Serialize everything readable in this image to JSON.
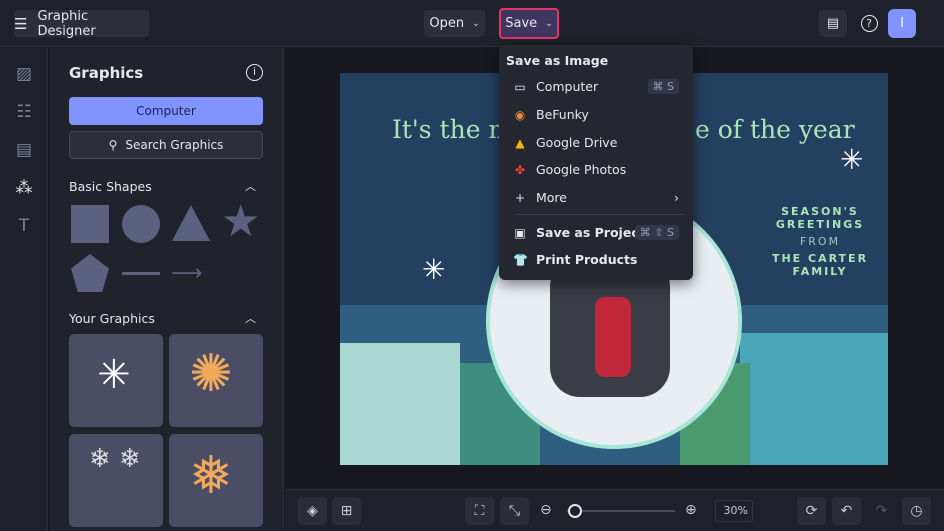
{
  "header": {
    "app_title": "Graphic Designer",
    "open_label": "Open",
    "save_label": "Save",
    "avatar_initial": "I"
  },
  "panel": {
    "title": "Graphics",
    "computer_label": "Computer",
    "search_label": "Search Graphics",
    "basic_shapes": "Basic Shapes",
    "your_graphics": "Your Graphics"
  },
  "save_menu": {
    "heading": "Save as Image",
    "items": [
      {
        "label": "Computer",
        "shortcut": "⌘ S"
      },
      {
        "label": "BeFunky"
      },
      {
        "label": "Google Drive"
      },
      {
        "label": "Google Photos"
      },
      {
        "label": "More"
      }
    ],
    "project": {
      "label": "Save as Project",
      "shortcut": "⌘ ⇧ S"
    },
    "print": {
      "label": "Print Products"
    }
  },
  "card": {
    "headline_left": "It's the mo",
    "headline_right": "e of the year",
    "line1": "SEASON'S",
    "line2": "GREETINGS",
    "line3": "FROM",
    "line4": "THE CARTER",
    "line5": "FAMILY"
  },
  "toolbar": {
    "zoom_value": "30%",
    "zoom_fraction": 0.03
  },
  "colors": {
    "accent": "#8093ff",
    "save_highlight": "#e5336a",
    "card_bg": "#244060"
  }
}
